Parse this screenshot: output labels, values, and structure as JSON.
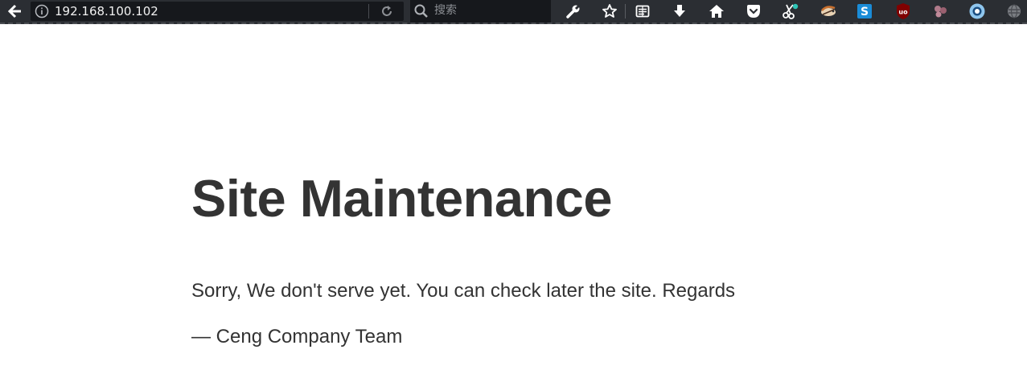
{
  "browser": {
    "url": "192.168.100.102",
    "search_placeholder": "搜索",
    "toolbar_icons": [
      "back-arrow-icon",
      "info-icon",
      "reload-icon",
      "search-icon",
      "wrench-icon",
      "star-icon",
      "reader-icon",
      "download-icon",
      "home-icon",
      "pocket-icon",
      "scissors-icon",
      "bird-extension-icon",
      "s-extension-icon",
      "ublock-icon",
      "dots-extension-icon",
      "ring-extension-icon",
      "globe-extension-icon"
    ],
    "colors": {
      "toolbar_bg": "#2b2e33",
      "urlbar_bg": "#16181c",
      "pocket": "#ef4056",
      "s_extension": "#1a8cd8",
      "ublock": "#800000",
      "ring": "#8fc6ee"
    }
  },
  "page": {
    "title": "Site Maintenance",
    "message": "Sorry, We don't serve yet. You can check later the site. Regards",
    "signature": "— Ceng Company Team",
    "text_color": "#333333",
    "background": "#ffffff"
  }
}
